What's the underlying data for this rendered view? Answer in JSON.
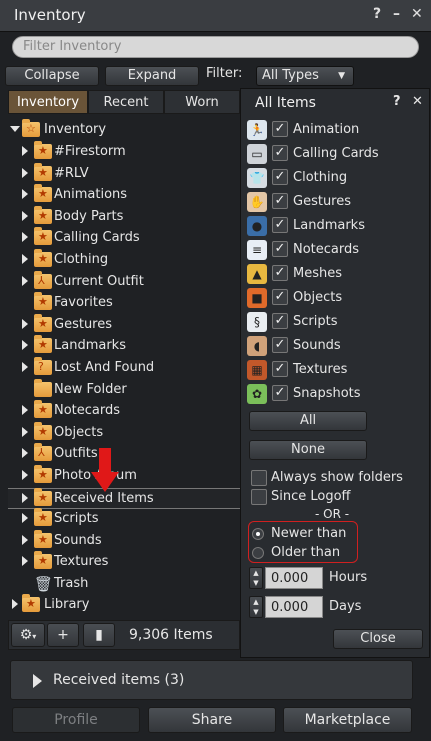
{
  "window": {
    "title": "Inventory",
    "help": "?",
    "minimize": "–",
    "close": "✕"
  },
  "search": {
    "placeholder": "Filter Inventory"
  },
  "toolbar": {
    "collapse": "Collapse",
    "expand": "Expand",
    "filter_label": "Filter:",
    "filter_value": "All Types"
  },
  "tabs": [
    {
      "label": "Inventory",
      "active": true
    },
    {
      "label": "Recent",
      "active": false
    },
    {
      "label": "Worn",
      "active": false
    }
  ],
  "tree": {
    "root": "Inventory",
    "items": [
      {
        "label": "#Firestorm",
        "arrow": true,
        "icon": "folder-star"
      },
      {
        "label": "#RLV",
        "arrow": true,
        "icon": "folder-star"
      },
      {
        "label": "Animations",
        "arrow": true,
        "icon": "folder-star"
      },
      {
        "label": "Body Parts",
        "arrow": true,
        "icon": "folder-star"
      },
      {
        "label": "Calling Cards",
        "arrow": true,
        "icon": "folder-star"
      },
      {
        "label": "Clothing",
        "arrow": true,
        "icon": "folder-star"
      },
      {
        "label": "Current Outfit",
        "arrow": true,
        "icon": "folder-outfit"
      },
      {
        "label": "Favorites",
        "arrow": false,
        "icon": "folder-star"
      },
      {
        "label": "Gestures",
        "arrow": true,
        "icon": "folder-star"
      },
      {
        "label": "Landmarks",
        "arrow": true,
        "icon": "folder-star"
      },
      {
        "label": "Lost And Found",
        "arrow": true,
        "icon": "folder-question"
      },
      {
        "label": "New Folder",
        "arrow": false,
        "icon": "folder-plain"
      },
      {
        "label": "Notecards",
        "arrow": true,
        "icon": "folder-star"
      },
      {
        "label": "Objects",
        "arrow": true,
        "icon": "folder-star"
      },
      {
        "label": "Outfits",
        "arrow": true,
        "icon": "folder-outfit"
      },
      {
        "label": "Photo Album",
        "arrow": true,
        "icon": "folder-star"
      },
      {
        "label": "Received Items",
        "arrow": true,
        "icon": "folder-star",
        "selected": true
      },
      {
        "label": "Scripts",
        "arrow": true,
        "icon": "folder-star"
      },
      {
        "label": "Sounds",
        "arrow": true,
        "icon": "folder-star"
      },
      {
        "label": "Textures",
        "arrow": true,
        "icon": "folder-star"
      },
      {
        "label": "Trash",
        "arrow": false,
        "icon": "trash-icon"
      }
    ],
    "library": "Library"
  },
  "bottom": {
    "gear": "⚙",
    "plus": "+",
    "trash": "▮",
    "count": "9,306 Items"
  },
  "panel": {
    "title": "All Items",
    "help": "?",
    "close": "✕",
    "types": [
      {
        "label": "Animation",
        "icon": "animation-icon",
        "glyph": "🏃",
        "bg": "#dde6ee"
      },
      {
        "label": "Calling Cards",
        "icon": "calling-card-icon",
        "glyph": "▭",
        "bg": "#cfd3d8"
      },
      {
        "label": "Clothing",
        "icon": "clothing-icon",
        "glyph": "👕",
        "bg": "#d7dde3"
      },
      {
        "label": "Gestures",
        "icon": "gesture-icon",
        "glyph": "✋",
        "bg": "#e3c6a6"
      },
      {
        "label": "Landmarks",
        "icon": "landmark-icon",
        "glyph": "●",
        "bg": "#3a6ea8"
      },
      {
        "label": "Notecards",
        "icon": "notecard-icon",
        "glyph": "≡",
        "bg": "#e8eef6"
      },
      {
        "label": "Meshes",
        "icon": "mesh-icon",
        "glyph": "▲",
        "bg": "#e8b840"
      },
      {
        "label": "Objects",
        "icon": "object-icon",
        "glyph": "■",
        "bg": "#e06a2a"
      },
      {
        "label": "Scripts",
        "icon": "script-icon",
        "glyph": "§",
        "bg": "#e9edf1"
      },
      {
        "label": "Sounds",
        "icon": "sound-icon",
        "glyph": "◖",
        "bg": "#d0a27a"
      },
      {
        "label": "Textures",
        "icon": "texture-icon",
        "glyph": "▦",
        "bg": "#c2582a"
      },
      {
        "label": "Snapshots",
        "icon": "snapshot-icon",
        "glyph": "✿",
        "bg": "#7bbf5a"
      }
    ],
    "all": "All",
    "none": "None",
    "always_show_folders": "Always show folders",
    "since_logoff": "Since Logoff",
    "or": "- OR -",
    "newer_than": "Newer than",
    "older_than": "Older than",
    "hours_value": "0.000",
    "hours_label": "Hours",
    "days_value": "0.000",
    "days_label": "Days",
    "close_btn": "Close"
  },
  "received": {
    "label": "Received items (3)"
  },
  "footer": {
    "profile": "Profile",
    "share": "Share",
    "marketplace": "Marketplace"
  },
  "colors": {
    "accent_tab": "#6a5438",
    "annotation_red": "#d02020"
  }
}
